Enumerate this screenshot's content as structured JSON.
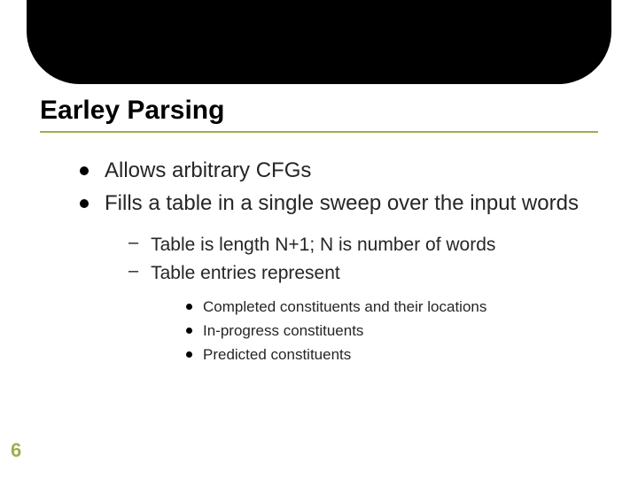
{
  "title": "Earley Parsing",
  "bullets": [
    {
      "text": "Allows arbitrary CFGs"
    },
    {
      "text": "Fills a table in a single sweep over the input words"
    }
  ],
  "subbullets": [
    {
      "text": "Table is length N+1; N is number of words"
    },
    {
      "text": "Table entries represent"
    }
  ],
  "subsubbullets": [
    {
      "text": "Completed constituents and their locations"
    },
    {
      "text": "In-progress constituents"
    },
    {
      "text": "Predicted constituents"
    }
  ],
  "page_number": "6"
}
